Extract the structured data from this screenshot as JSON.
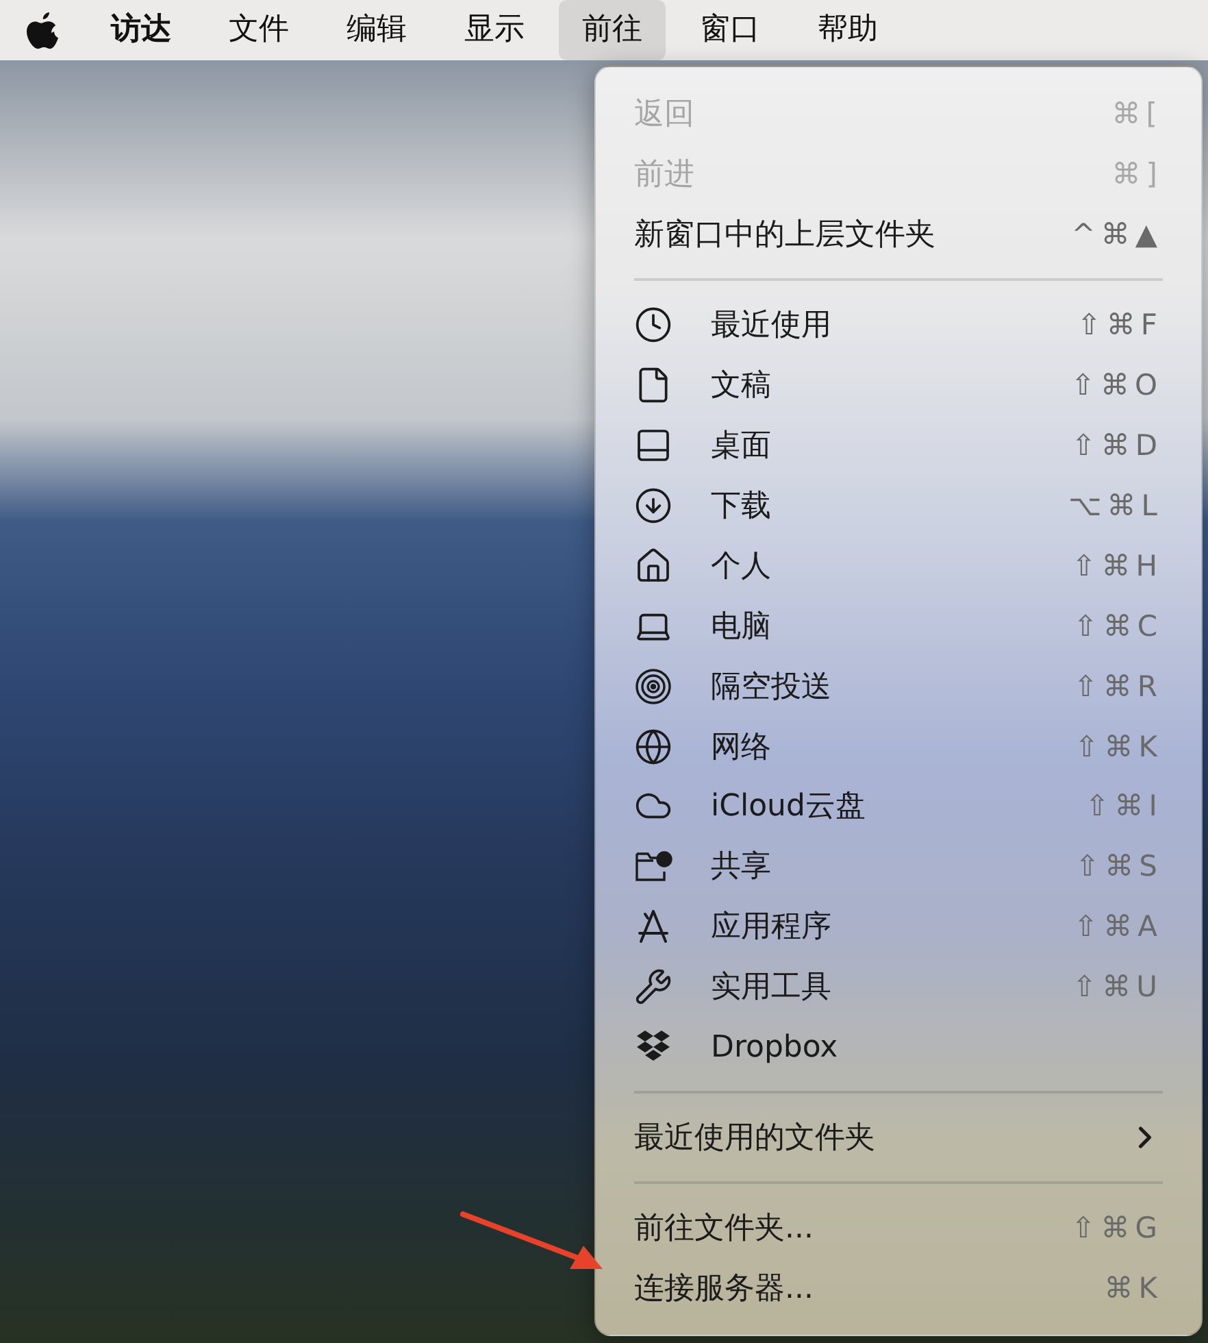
{
  "menubar": {
    "items": [
      {
        "label": "访达",
        "selected": false,
        "bold": true
      },
      {
        "label": "文件",
        "selected": false,
        "bold": false
      },
      {
        "label": "编辑",
        "selected": false,
        "bold": false
      },
      {
        "label": "显示",
        "selected": false,
        "bold": false
      },
      {
        "label": "前往",
        "selected": true,
        "bold": false
      },
      {
        "label": "窗口",
        "selected": false,
        "bold": false
      },
      {
        "label": "帮助",
        "selected": false,
        "bold": false
      }
    ]
  },
  "menu": {
    "sections": [
      {
        "items": [
          {
            "kind": "plain",
            "label": "返回",
            "shortcut": "⌘[",
            "disabled": true
          },
          {
            "kind": "plain",
            "label": "前进",
            "shortcut": "⌘]",
            "disabled": true
          },
          {
            "kind": "plain",
            "label": "新窗口中的上层文件夹",
            "shortcut": "^⌘▲",
            "disabled": false
          }
        ]
      },
      {
        "items": [
          {
            "kind": "place",
            "label": "最近使用",
            "shortcut": "⇧⌘F",
            "disabled": false
          },
          {
            "kind": "place",
            "label": "文稿",
            "shortcut": "⇧⌘O",
            "disabled": false
          },
          {
            "kind": "place",
            "label": "桌面",
            "shortcut": "⇧⌘D",
            "disabled": false
          },
          {
            "kind": "place",
            "label": "下载",
            "shortcut": "⌥⌘L",
            "disabled": false
          },
          {
            "kind": "place",
            "label": "个人",
            "shortcut": "⇧⌘H",
            "disabled": false
          },
          {
            "kind": "place",
            "label": "电脑",
            "shortcut": "⇧⌘C",
            "disabled": false
          },
          {
            "kind": "place",
            "label": "隔空投送",
            "shortcut": "⇧⌘R",
            "disabled": false
          },
          {
            "kind": "place",
            "label": "网络",
            "shortcut": "⇧⌘K",
            "disabled": false
          },
          {
            "kind": "place",
            "label": "iCloud云盘",
            "shortcut": "⇧⌘I",
            "disabled": false
          },
          {
            "kind": "place",
            "label": "共享",
            "shortcut": "⇧⌘S",
            "disabled": false
          },
          {
            "kind": "place",
            "label": "应用程序",
            "shortcut": "⇧⌘A",
            "disabled": false
          },
          {
            "kind": "place",
            "label": "实用工具",
            "shortcut": "⇧⌘U",
            "disabled": false
          },
          {
            "kind": "place",
            "label": "Dropbox",
            "disabled": false
          }
        ]
      },
      {
        "items": [
          {
            "kind": "submenu",
            "label": "最近使用的文件夹",
            "disabled": false
          }
        ]
      },
      {
        "items": [
          {
            "kind": "plain",
            "label": "前往文件夹...",
            "shortcut": "⇧⌘G",
            "disabled": false
          },
          {
            "kind": "plain",
            "label": "连接服务器...",
            "shortcut": "⌘K",
            "disabled": false
          }
        ]
      }
    ]
  }
}
